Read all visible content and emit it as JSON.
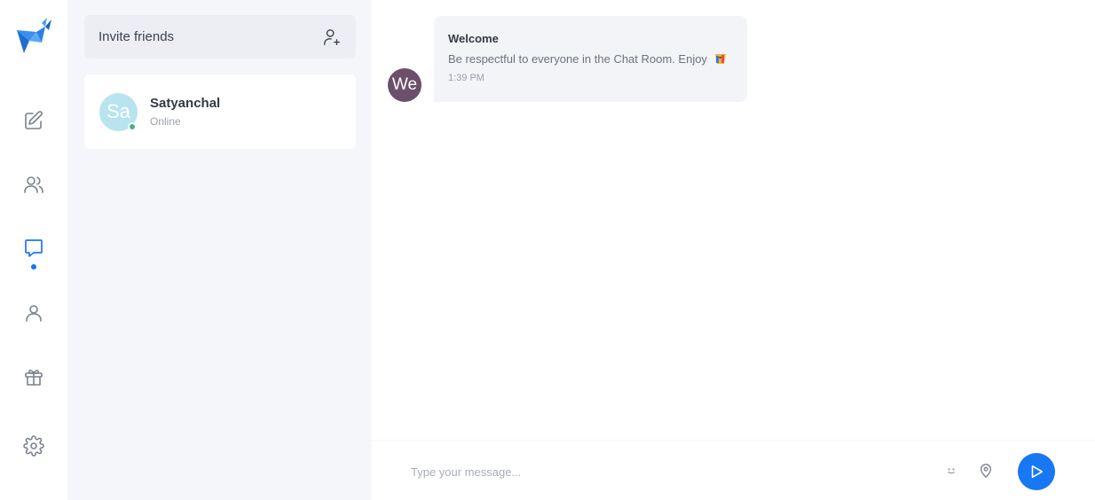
{
  "theme": {
    "accent": "#1877f2",
    "online": "#43b581",
    "we_avatar": "#6b4f6b",
    "sa_avatar": "#b7e4ef"
  },
  "rail": {
    "logo": "bird-logo",
    "items": [
      {
        "icon": "edit-icon",
        "active": false
      },
      {
        "icon": "users-icon",
        "active": false
      },
      {
        "icon": "chat-icon",
        "active": true
      },
      {
        "icon": "user-icon",
        "active": false
      },
      {
        "icon": "gift-icon",
        "active": false
      },
      {
        "icon": "gear-icon",
        "active": false
      }
    ]
  },
  "contacts": {
    "invite_label": "Invite friends",
    "invite_icon": "add-user-icon",
    "list": [
      {
        "initials": "Sa",
        "name": "Satyanchal",
        "status": "Online"
      }
    ]
  },
  "chat": {
    "messages": [
      {
        "avatar_initials": "We",
        "sender": "Welcome",
        "text": "Be respectful to everyone in the Chat Room. Enjoy",
        "emoji": "party-emoji",
        "time": "1:39 PM"
      }
    ],
    "composer": {
      "placeholder": "Type your message...",
      "emoji_icon": "smile-icon",
      "location_icon": "location-pin-icon",
      "send_icon": "send-icon"
    }
  }
}
